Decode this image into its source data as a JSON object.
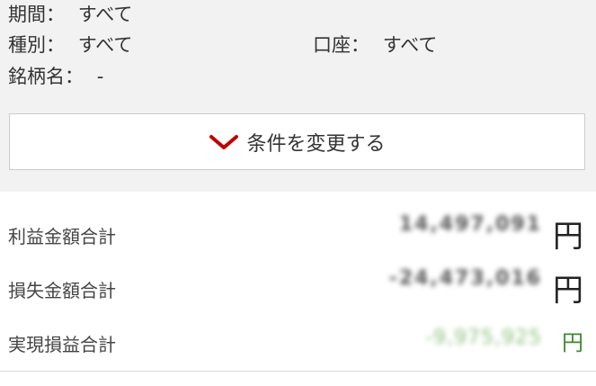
{
  "filters": {
    "period": {
      "label": "期間：",
      "value": "すべて"
    },
    "type": {
      "label": "種別：",
      "value": "すべて"
    },
    "account": {
      "label": "口座：",
      "value": "すべて"
    },
    "issue": {
      "label": "銘柄名：",
      "value": "-"
    }
  },
  "change_button": {
    "label": "条件を変更する",
    "icon": "chevron-down-icon",
    "icon_color": "#c00000"
  },
  "summary": {
    "profit_total": {
      "label": "利益金額合計",
      "amount": "14,497,091",
      "unit": "円"
    },
    "loss_total": {
      "label": "損失金額合計",
      "amount": "-24,473,016",
      "unit": "円"
    },
    "net_total": {
      "label": "実現損益合計",
      "amount": "-9,975,925",
      "unit": "円",
      "color": "#3c8c2c"
    }
  }
}
